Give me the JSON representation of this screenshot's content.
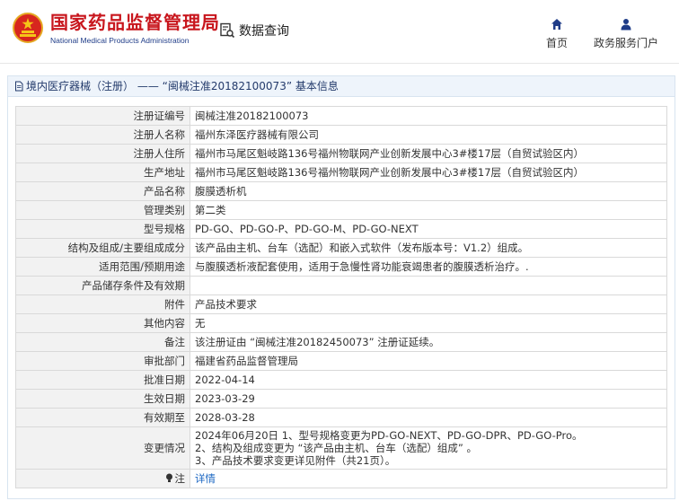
{
  "header": {
    "brand_cn": "国家药品监督管理局",
    "brand_en": "National Medical Products Administration",
    "data_query": "数据查询",
    "nav_home": "首页",
    "nav_gov": "政务服务门户"
  },
  "breadcrumb": "境内医疗器械（注册） —— “闽械注准20182100073” 基本信息",
  "rows": [
    {
      "k": "注册证编号",
      "v": "闽械注准20182100073"
    },
    {
      "k": "注册人名称",
      "v": "福州东泽医疗器械有限公司"
    },
    {
      "k": "注册人住所",
      "v": "福州市马尾区魁岐路136号福州物联网产业创新发展中心3#楼17层（自贸试验区内）"
    },
    {
      "k": "生产地址",
      "v": "福州市马尾区魁岐路136号福州物联网产业创新发展中心3#楼17层（自贸试验区内）"
    },
    {
      "k": "产品名称",
      "v": "腹膜透析机"
    },
    {
      "k": "管理类别",
      "v": "第二类"
    },
    {
      "k": "型号规格",
      "v": "PD-GO、PD-GO-P、PD-GO-M、PD-GO-NEXT"
    },
    {
      "k": "结构及组成/主要组成成分",
      "v": "该产品由主机、台车（选配）和嵌入式软件（发布版本号：V1.2）组成。"
    },
    {
      "k": "适用范围/预期用途",
      "v": "与腹膜透析液配套使用，适用于急慢性肾功能衰竭患者的腹膜透析治疗。."
    },
    {
      "k": "产品储存条件及有效期",
      "v": ""
    },
    {
      "k": "附件",
      "v": "产品技术要求"
    },
    {
      "k": "其他内容",
      "v": "无"
    },
    {
      "k": "备注",
      "v": "该注册证由 “闽械注准20182450073” 注册证延续。"
    },
    {
      "k": "审批部门",
      "v": "福建省药品监督管理局"
    },
    {
      "k": "批准日期",
      "v": "2022-04-14"
    },
    {
      "k": "生效日期",
      "v": "2023-03-29"
    },
    {
      "k": "有效期至",
      "v": "2028-03-28"
    },
    {
      "k": "变更情况",
      "lines": [
        "2024年06月20日 1、型号规格变更为PD-GO-NEXT、PD-GO-DPR、PD-GO-Pro。",
        "2、结构及组成变更为 “该产品由主机、台车（选配）组成” 。",
        "3、产品技术要求变更详见附件（共21页）。"
      ]
    },
    {
      "k": "注",
      "v": "详情",
      "link": true
    }
  ],
  "colors": {
    "brand_red": "#c8161d",
    "brand_blue": "#1f3c88",
    "link": "#1a66c2"
  }
}
